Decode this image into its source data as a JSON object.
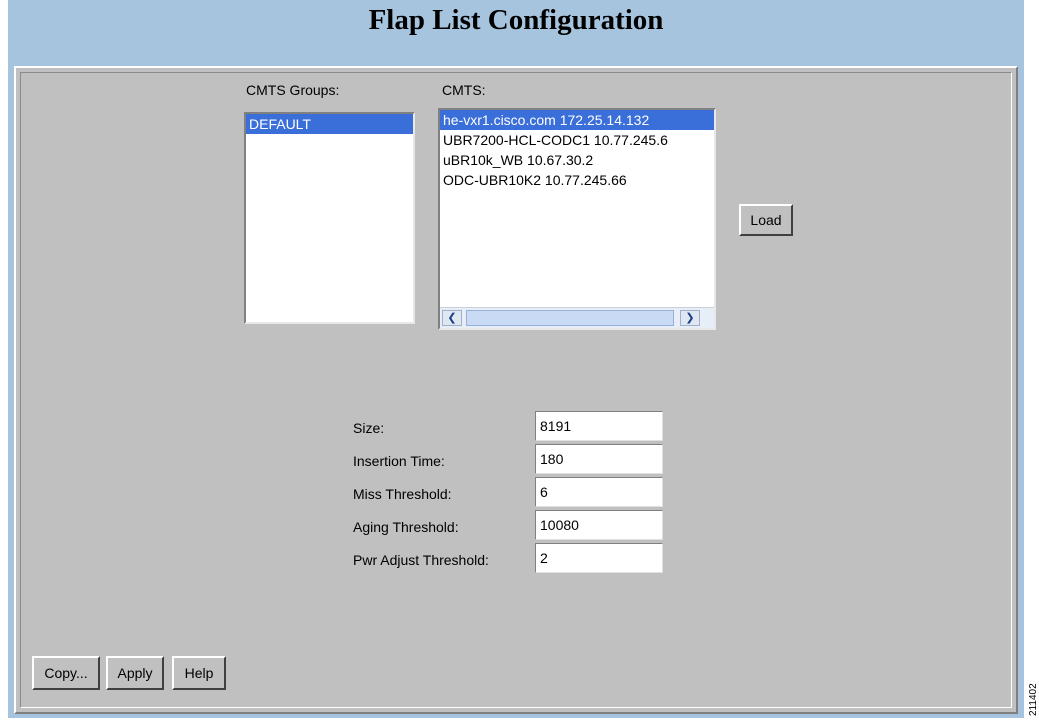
{
  "page": {
    "title": "Flap List Configuration"
  },
  "cmts_groups": {
    "label": "CMTS Groups:",
    "items": [
      {
        "label": "DEFAULT",
        "selected": true
      }
    ]
  },
  "cmts": {
    "label": "CMTS:",
    "items": [
      {
        "label": "he-vxr1.cisco.com 172.25.14.132",
        "selected": true
      },
      {
        "label": "UBR7200-HCL-CODC1 10.77.245.6",
        "selected": false
      },
      {
        "label": "uBR10k_WB 10.67.30.2",
        "selected": false
      },
      {
        "label": "ODC-UBR10K2 10.77.245.66",
        "selected": false
      }
    ]
  },
  "load_button": "Load",
  "fields": [
    {
      "label": "Size:",
      "value": "8191"
    },
    {
      "label": "Insertion Time:",
      "value": "180"
    },
    {
      "label": "Miss Threshold:",
      "value": "6"
    },
    {
      "label": "Aging Threshold:",
      "value": "10080"
    },
    {
      "label": "Pwr Adjust Threshold:",
      "value": "2"
    }
  ],
  "footer": {
    "copy": "Copy...",
    "apply": "Apply",
    "help": "Help"
  },
  "figure_id": "211402",
  "colors": {
    "background": "#a7c4de",
    "panel": "#c0c0c0",
    "selection": "#3a6ed8"
  }
}
